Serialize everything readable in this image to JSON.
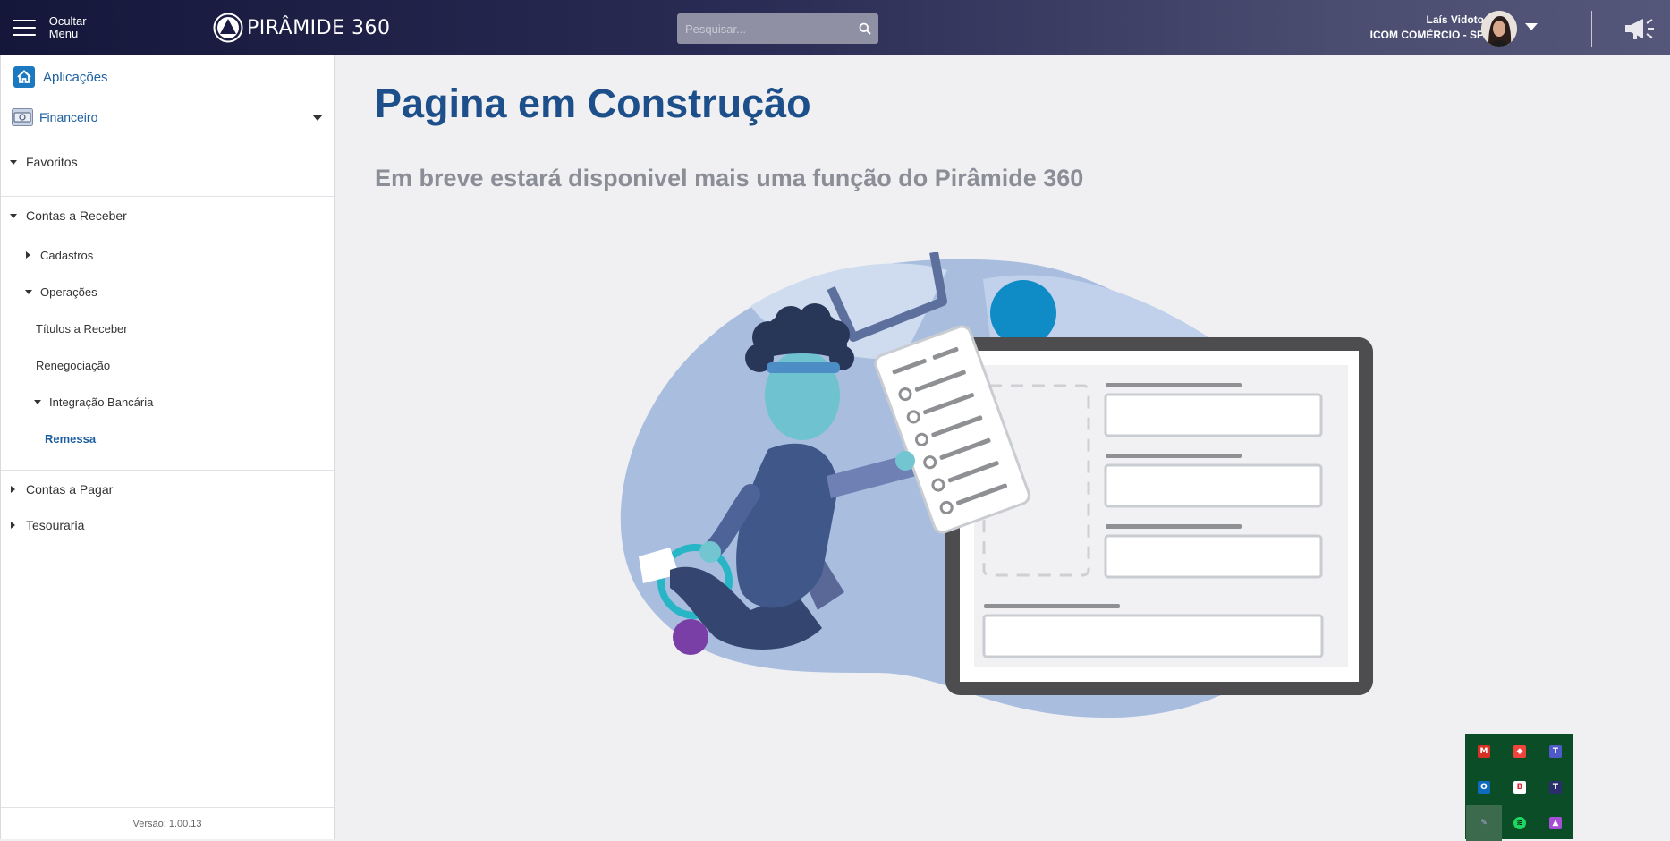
{
  "header": {
    "menu_toggle_label": "Ocultar Menu",
    "brand": "PIRÂMIDE 360",
    "search_placeholder": "Pesquisar...",
    "user_name": "Laís Vidoto",
    "user_company": "ICOM COMÉRCIO - SP"
  },
  "sidebar": {
    "applications": "Aplicações",
    "module": "Financeiro",
    "favorites": "Favoritos",
    "contas_receber": "Contas a Receber",
    "cadastros": "Cadastros",
    "operacoes": "Operações",
    "titulos": "Títulos a Receber",
    "renegociacao": "Renegociação",
    "integracao": "Integração Bancária",
    "remessa": "Remessa",
    "contas_pagar": "Contas a Pagar",
    "tesouraria": "Tesouraria",
    "version": "Versão: 1.00.13"
  },
  "main": {
    "title": "Pagina em Construção",
    "subtitle": "Em breve estará disponivel mais uma função do Pirâmide 360"
  },
  "tray": {
    "icons": [
      "gmail-icon",
      "anydesk-icon",
      "teams-icon",
      "outlook-icon",
      "bitdefender-icon",
      "teams-2-icon",
      "pen-icon",
      "spotify-icon",
      "photos-icon"
    ]
  },
  "colors": {
    "header_start": "#14163a",
    "header_end": "#55577a",
    "title": "#1d4f8a",
    "subtitle": "#8b8e96",
    "active_link": "#1d5fa0",
    "tray_bg": "#0a4d26"
  }
}
